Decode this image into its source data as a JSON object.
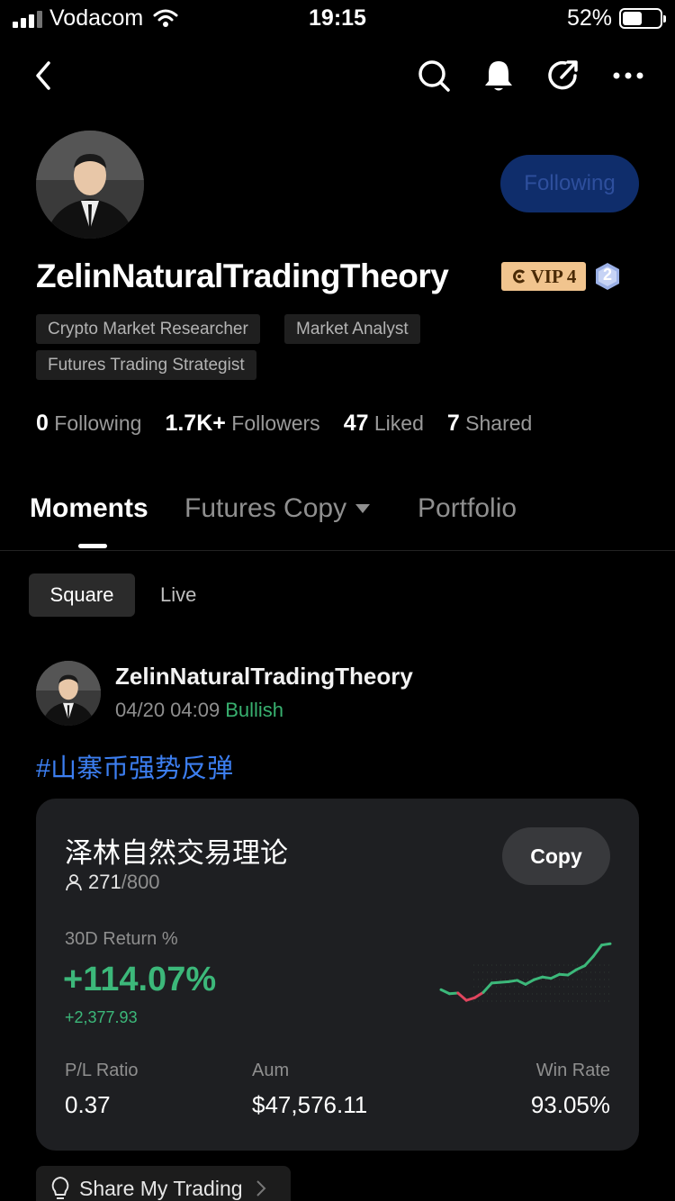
{
  "status_bar": {
    "carrier": "Vodacom",
    "time": "19:15",
    "battery": "52%"
  },
  "profile": {
    "follow_label": "Following",
    "username": "ZelinNaturalTradingTheory",
    "vip_label": "VIP 4",
    "level_badge": "2",
    "tags": [
      "Crypto Market Researcher",
      "Market Analyst",
      "Futures Trading Strategist"
    ],
    "stats": [
      {
        "value": "0",
        "label": "Following"
      },
      {
        "value": "1.7K+",
        "label": "Followers"
      },
      {
        "value": "47",
        "label": "Liked"
      },
      {
        "value": "7",
        "label": "Shared"
      }
    ]
  },
  "tabs": [
    "Moments",
    "Futures Copy",
    "Portfolio"
  ],
  "segments": [
    "Square",
    "Live"
  ],
  "post": {
    "author": "ZelinNaturalTradingTheory",
    "datetime": "04/20 04:09",
    "sentiment": "Bullish",
    "hashtag": "#山寨币强势反弹"
  },
  "copy_card": {
    "title": "泽林自然交易理论",
    "copiers": "271",
    "copiers_max": "/800",
    "copy_label": "Copy",
    "return_label": "30D Return %",
    "return_value": "+114.07%",
    "return_abs": "+2,377.93",
    "metrics": [
      {
        "label": "P/L Ratio",
        "value": "0.37"
      },
      {
        "label": "Aum",
        "value": "$47,576.11"
      },
      {
        "label": "Win Rate",
        "value": "93.05%"
      }
    ],
    "sparkline": [
      0.28,
      0.22,
      0.23,
      0.12,
      0.16,
      0.24,
      0.38,
      0.39,
      0.4,
      0.42,
      0.36,
      0.43,
      0.47,
      0.45,
      0.51,
      0.5,
      0.58,
      0.64,
      0.78,
      0.95,
      0.97
    ],
    "colors": {
      "positive": "#3cb87a",
      "negative": "#e0455e"
    }
  },
  "share_label": "Share My Trading"
}
